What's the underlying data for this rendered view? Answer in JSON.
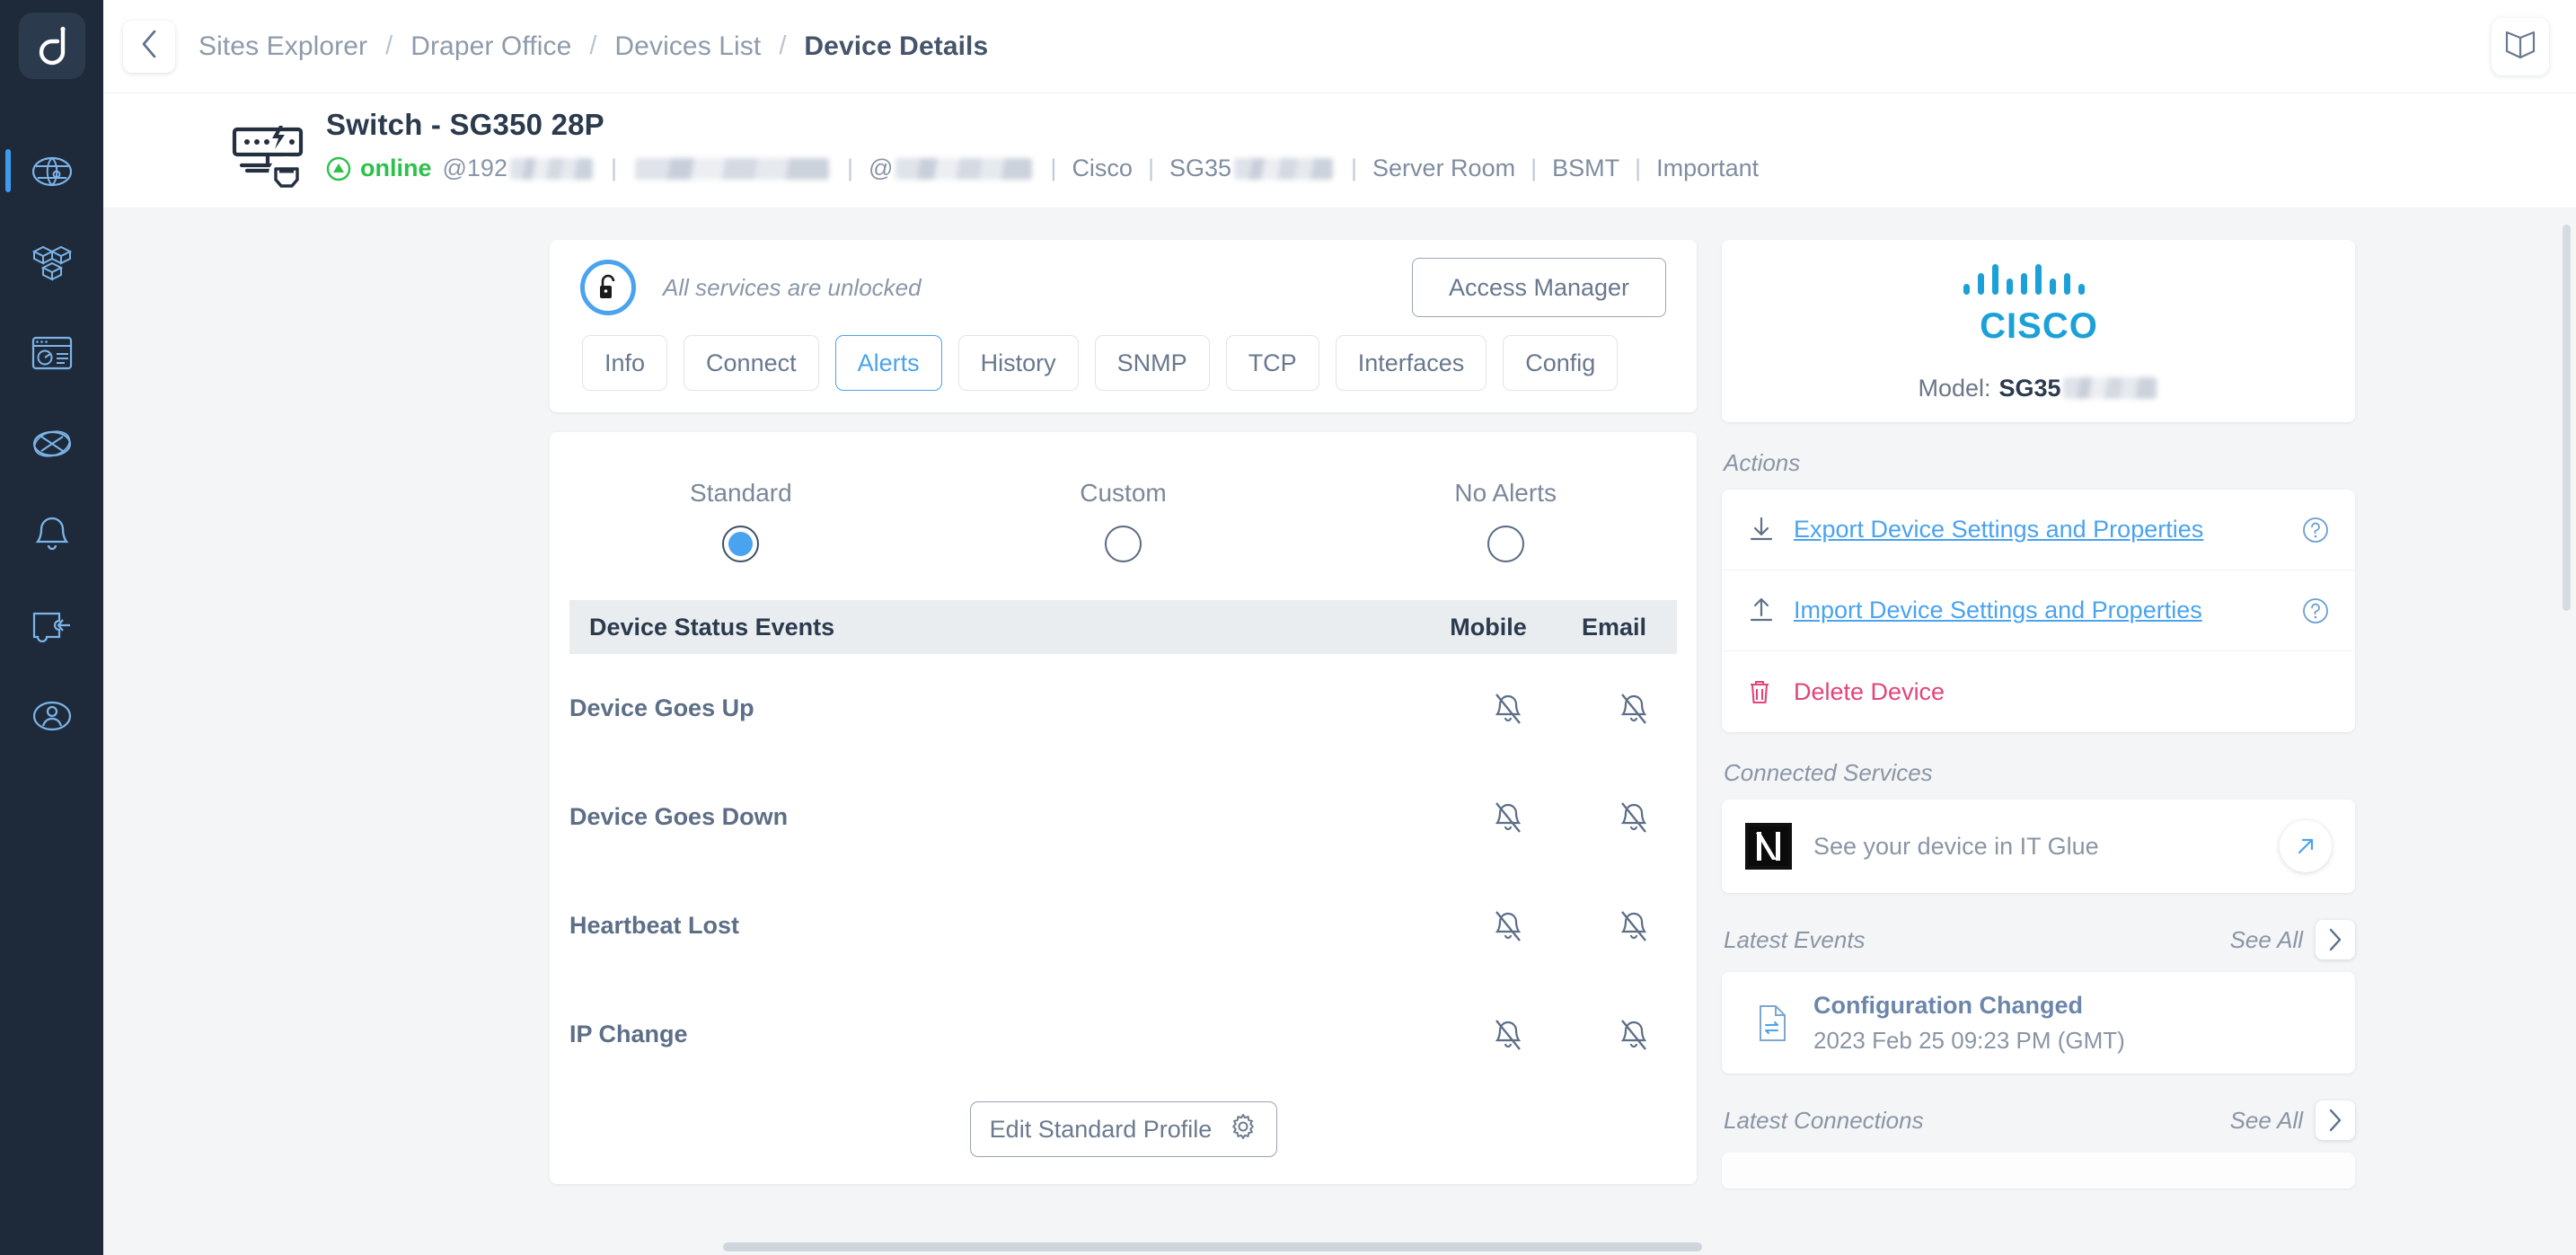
{
  "brand": {
    "logo_glyph": "domotz-logo",
    "accent": "#4aa3ef",
    "rail_bg": "#1e2a3a"
  },
  "rail": {
    "items": [
      {
        "name": "sites-explorer",
        "icon": "globe-network-icon",
        "active": true
      },
      {
        "name": "inventory",
        "icon": "cubes-icon",
        "active": false
      },
      {
        "name": "reports",
        "icon": "dashboard-icon",
        "active": false
      },
      {
        "name": "network-topology",
        "icon": "topology-icon",
        "active": false
      },
      {
        "name": "alerts",
        "icon": "bell-icon",
        "active": false
      },
      {
        "name": "tickets",
        "icon": "ticket-icon",
        "active": false
      },
      {
        "name": "account",
        "icon": "user-icon",
        "active": false
      }
    ]
  },
  "breadcrumb": {
    "back_icon": "chevron-left-icon",
    "items": [
      "Sites Explorer",
      "Draper Office",
      "Devices List",
      "Device Details"
    ],
    "separator": "/",
    "book_icon": "open-book-icon"
  },
  "device": {
    "icon": "poe-switch-icon",
    "title": "Switch - SG350 28P",
    "status": "online",
    "status_color": "#2cc14a",
    "ip_prefix": "@192",
    "vendor": "Cisco",
    "model_prefix": "SG35",
    "location": "Server Room",
    "zone": "BSMT",
    "importance": "Important",
    "separator": "|",
    "at_symbol": "@",
    "edit_icon": "pencil-icon"
  },
  "access_banner": {
    "icon": "unlocked-padlock-icon",
    "text": "All services are unlocked",
    "button_label": "Access Manager"
  },
  "tabs": [
    {
      "label": "Info",
      "active": false
    },
    {
      "label": "Connect",
      "active": false
    },
    {
      "label": "Alerts",
      "active": true
    },
    {
      "label": "History",
      "active": false
    },
    {
      "label": "SNMP",
      "active": false
    },
    {
      "label": "TCP",
      "active": false
    },
    {
      "label": "Interfaces",
      "active": false
    },
    {
      "label": "Config",
      "active": false
    }
  ],
  "alerts": {
    "profiles": [
      {
        "label": "Standard",
        "selected": true
      },
      {
        "label": "Custom",
        "selected": false
      },
      {
        "label": "No Alerts",
        "selected": false
      }
    ],
    "table": {
      "headers": [
        "Device Status Events",
        "Mobile",
        "Email"
      ],
      "rows": [
        {
          "event": "Device Goes Up",
          "mobile": "bell-off-icon",
          "email": "bell-off-icon"
        },
        {
          "event": "Device Goes Down",
          "mobile": "bell-off-icon",
          "email": "bell-off-icon"
        },
        {
          "event": "Heartbeat Lost",
          "mobile": "bell-off-icon",
          "email": "bell-off-icon"
        },
        {
          "event": "IP Change",
          "mobile": "bell-off-icon",
          "email": "bell-off-icon"
        }
      ]
    },
    "edit_button": {
      "label": "Edit Standard Profile",
      "icon": "gear-icon"
    }
  },
  "side": {
    "vendor_card": {
      "logo": "cisco-logo",
      "logo_color": "#1ba0d7",
      "model_label": "Model:",
      "model_value": "SG35"
    },
    "actions_label": "Actions",
    "actions": [
      {
        "label": "Export Device Settings and Properties",
        "icon": "download-icon",
        "help_icon": "question-circle-icon",
        "kind": "link"
      },
      {
        "label": "Import Device Settings and Properties",
        "icon": "upload-icon",
        "help_icon": "question-circle-icon",
        "kind": "link"
      },
      {
        "label": "Delete Device",
        "icon": "trash-icon",
        "kind": "danger"
      }
    ],
    "connected_services_label": "Connected Services",
    "itglue": {
      "logo": "itglue-logo",
      "text": "See your device in IT Glue",
      "go_icon": "arrow-up-right-icon"
    },
    "latest_events_label": "Latest Events",
    "latest_events_see_all": "See All",
    "latest_events": [
      {
        "icon": "config-file-icon",
        "title": "Configuration Changed",
        "date": "2023 Feb 25 09:23 PM (GMT)"
      }
    ],
    "latest_connections_label": "Latest Connections",
    "latest_connections_see_all": "See All",
    "chevron_icon": "chevron-right-icon"
  }
}
